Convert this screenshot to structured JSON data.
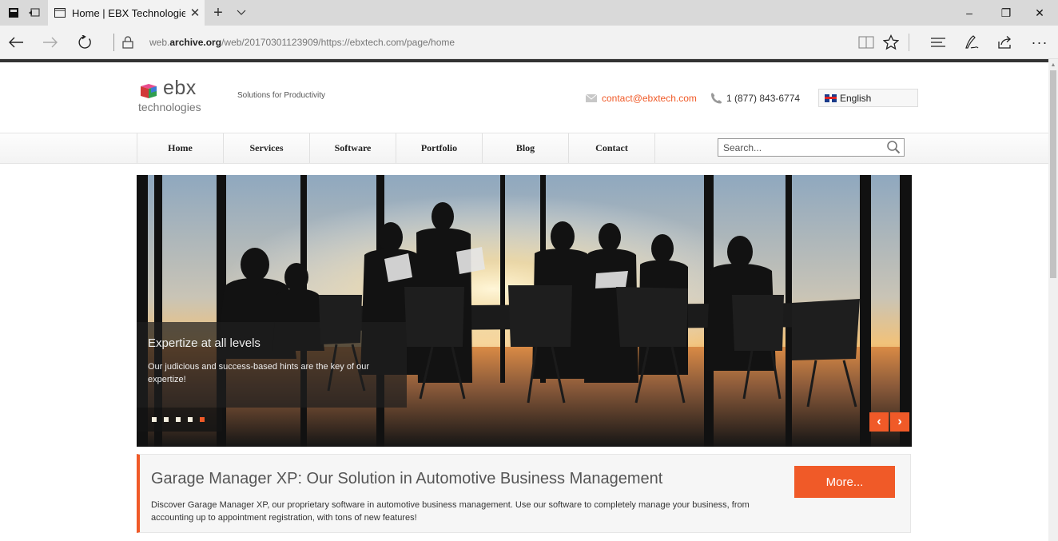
{
  "browser": {
    "tab": {
      "title": "Home | EBX Technologie",
      "close_icon": "close-icon"
    },
    "url": {
      "prefix": "web.",
      "domain": "archive.org",
      "path": "/web/20170301123909/https://ebxtech.com/page/home"
    },
    "window_controls": {
      "minimize": "–",
      "restore": "❐",
      "close": "✕"
    },
    "icons": [
      "back-icon",
      "forward-icon",
      "refresh-icon",
      "lock-icon",
      "reading-view-icon",
      "favorite-star-icon",
      "hub-icon",
      "web-note-icon",
      "share-icon",
      "more-icon"
    ]
  },
  "header": {
    "logo": {
      "name": "ebx",
      "subtitle": "technologies"
    },
    "tagline": "Solutions for Productivity",
    "email": "contact@ebxtech.com",
    "phone": "1 (877) 843-6774",
    "language": "English"
  },
  "menu": {
    "items": [
      {
        "label": "Home"
      },
      {
        "label": "Services"
      },
      {
        "label": "Software"
      },
      {
        "label": "Portfolio"
      },
      {
        "label": "Blog"
      },
      {
        "label": "Contact"
      }
    ],
    "search_placeholder": "Search..."
  },
  "hero": {
    "title": "Expertize at all levels",
    "text": "Our judicious and success-based hints are the key of our expertize!",
    "slide_count": 5,
    "active_slide": 5,
    "prev_label": "‹",
    "next_label": "›"
  },
  "promo": {
    "title": "Garage Manager XP: Our Solution in Automotive Business Management",
    "text": "Discover Garage Manager XP, our proprietary software in automotive business management. Use our software to completely manage your business, from accounting up to appointment registration, with tons of new features!",
    "button": "More..."
  },
  "colors": {
    "accent": "#f05a28",
    "titlebar": "#d9d9d9",
    "addressbar": "#f2f2f2"
  }
}
